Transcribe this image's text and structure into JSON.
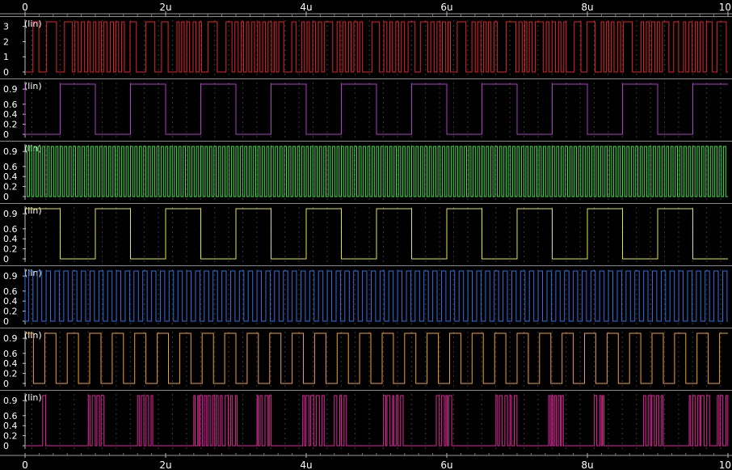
{
  "chart_data": {
    "type": "line",
    "title": "",
    "x_ticks": [
      "0",
      "2u",
      "4u",
      "6u",
      "8u",
      "10"
    ],
    "x_range_us": [
      0,
      10
    ],
    "panels": [
      {
        "color": "#e0262a",
        "scale_label": "(lin)",
        "y_ticks": [
          "3",
          "2",
          "1",
          "0"
        ],
        "ylim": [
          0,
          3.3
        ],
        "low": 0,
        "high": 3.3,
        "signal": "dense"
      },
      {
        "color": "#b13cc9",
        "scale_label": "(lin)",
        "y_ticks": [
          "0.9",
          "0.6",
          "0.4",
          "0.2",
          "0"
        ],
        "ylim": [
          0,
          1
        ],
        "low": 0,
        "high": 1.0,
        "signal": "square",
        "period_us": 1.0,
        "first_rise_us": 0.5
      },
      {
        "color": "#3fe04a",
        "scale_label": "(lin)",
        "y_ticks": [
          "0.9",
          "0.6",
          "0.4",
          "0.2",
          "0"
        ],
        "ylim": [
          0,
          1
        ],
        "low": 0,
        "high": 1.0,
        "signal": "square",
        "period_us": 0.0625,
        "first_rise_us": 0.0
      },
      {
        "color": "#e2e63a",
        "scale_label": "(lin)",
        "y_ticks": [
          "0.9",
          "0.6",
          "0.4",
          "0.2",
          "0"
        ],
        "ylim": [
          0,
          1
        ],
        "low": 0,
        "high": 1.0,
        "signal": "square",
        "period_us": 1.0,
        "first_rise_us": 1.0
      },
      {
        "color": "#2f6fe0",
        "scale_label": "(lin)",
        "y_ticks": [
          "0.9",
          "0.6",
          "0.4",
          "0.2",
          "0"
        ],
        "ylim": [
          0,
          1
        ],
        "low": 0,
        "high": 1.0,
        "signal": "square",
        "period_us": 0.125,
        "first_rise_us": 0.05
      },
      {
        "color": "#f0a030",
        "scale_label": "(lin)",
        "y_ticks": [
          "0.9",
          "0.6",
          "0.4",
          "0.2",
          "0"
        ],
        "ylim": [
          0,
          1
        ],
        "low": 0,
        "high": 1.0,
        "signal": "square",
        "period_us": 0.32,
        "first_rise_us": 0.28
      },
      {
        "color": "#e0289a",
        "scale_label": "(lin)",
        "y_ticks": [
          "0.9",
          "0.6",
          "0.4",
          "0.2",
          "0"
        ],
        "ylim": [
          0,
          1
        ],
        "low": 0,
        "high": 1.0,
        "signal": "bursts"
      }
    ]
  }
}
